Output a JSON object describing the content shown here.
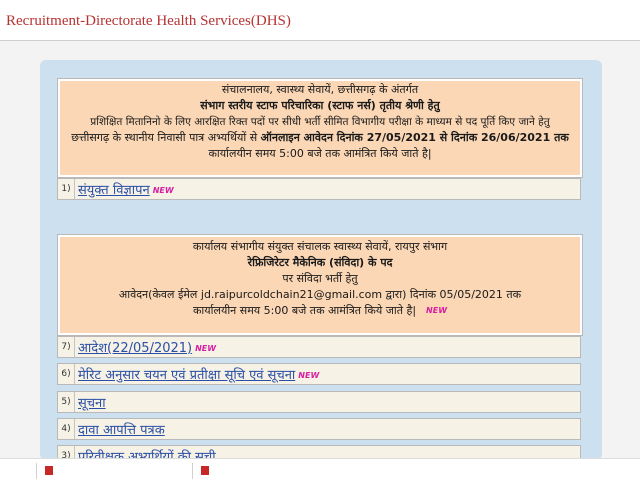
{
  "header": {
    "title": "Recruitment-Directorate Health Services(DHS)"
  },
  "notice1": {
    "line1": "संचालनालय, स्वास्थ्य सेवायें, छत्तीसगढ़ के अंतर्गत",
    "line2": "संभाग स्तरीय स्टाफ परिचारिका (स्टाफ नर्स) तृतीय श्रेणी हेतु",
    "line3": "प्रशिक्षित मितानिनो के लिए आरक्षित रिक्त पदों पर सीधी भर्ती सीमित विभागीय परीक्षा के माध्यम से पद पूर्ति किए जाने हेतु",
    "line4a": "छत्तीसगढ़ के स्थानीय निवासी पात्र अभ्यर्थियों से ",
    "line4b": "ऑनलाइन आवेदन दिनांक 27/05/2021 से दिनांक 26/06/2021 तक",
    "line5": "कार्यालयीन समय 5:00 बजे तक आमंत्रित किये जाते है|"
  },
  "notice1_items": [
    {
      "num": "1)",
      "label": "संयुक्त विज्ञापन",
      "new": "NEW"
    }
  ],
  "notice2": {
    "line1": "कार्यालय संभागीय संयुक्त संचालक स्वास्थ्य सेवायें, रायपुर संभाग",
    "line2": "रेफ्रिजिरेटर मैकेनिक (संविदा) के पद",
    "line3": "पर संविदा भर्ती हेतु",
    "line4": "आवेदन(केवल ईमेल jd.raipurcoldchain21@gmail.com द्वारा) दिनांक 05/05/2021 तक",
    "line5": "कार्यालयीन समय 5:00 बजे तक आमंत्रित किये जाते है|",
    "new": "NEW"
  },
  "notice2_items": [
    {
      "num": "7)",
      "label": "आदेश(22/05/2021)",
      "new": "NEW"
    },
    {
      "num": "6)",
      "label": "मेरिट अनुसार चयन एवं प्रतीक्षा सूचि एवं सूचना",
      "new": "NEW"
    },
    {
      "num": "5)",
      "label": "सूचना",
      "new": ""
    },
    {
      "num": "4)",
      "label": "दावा आपत्ति पत्रक",
      "new": ""
    },
    {
      "num": "3)",
      "label": "परिवीक्षक अभ्यर्थियों की सूची",
      "new": ""
    }
  ],
  "colors": {
    "title": "#b73232",
    "notice_bg": "#fbd7b5",
    "panel_bg": "#cde0ef",
    "link": "#2b4fa6",
    "badge": "#d61fa2"
  }
}
